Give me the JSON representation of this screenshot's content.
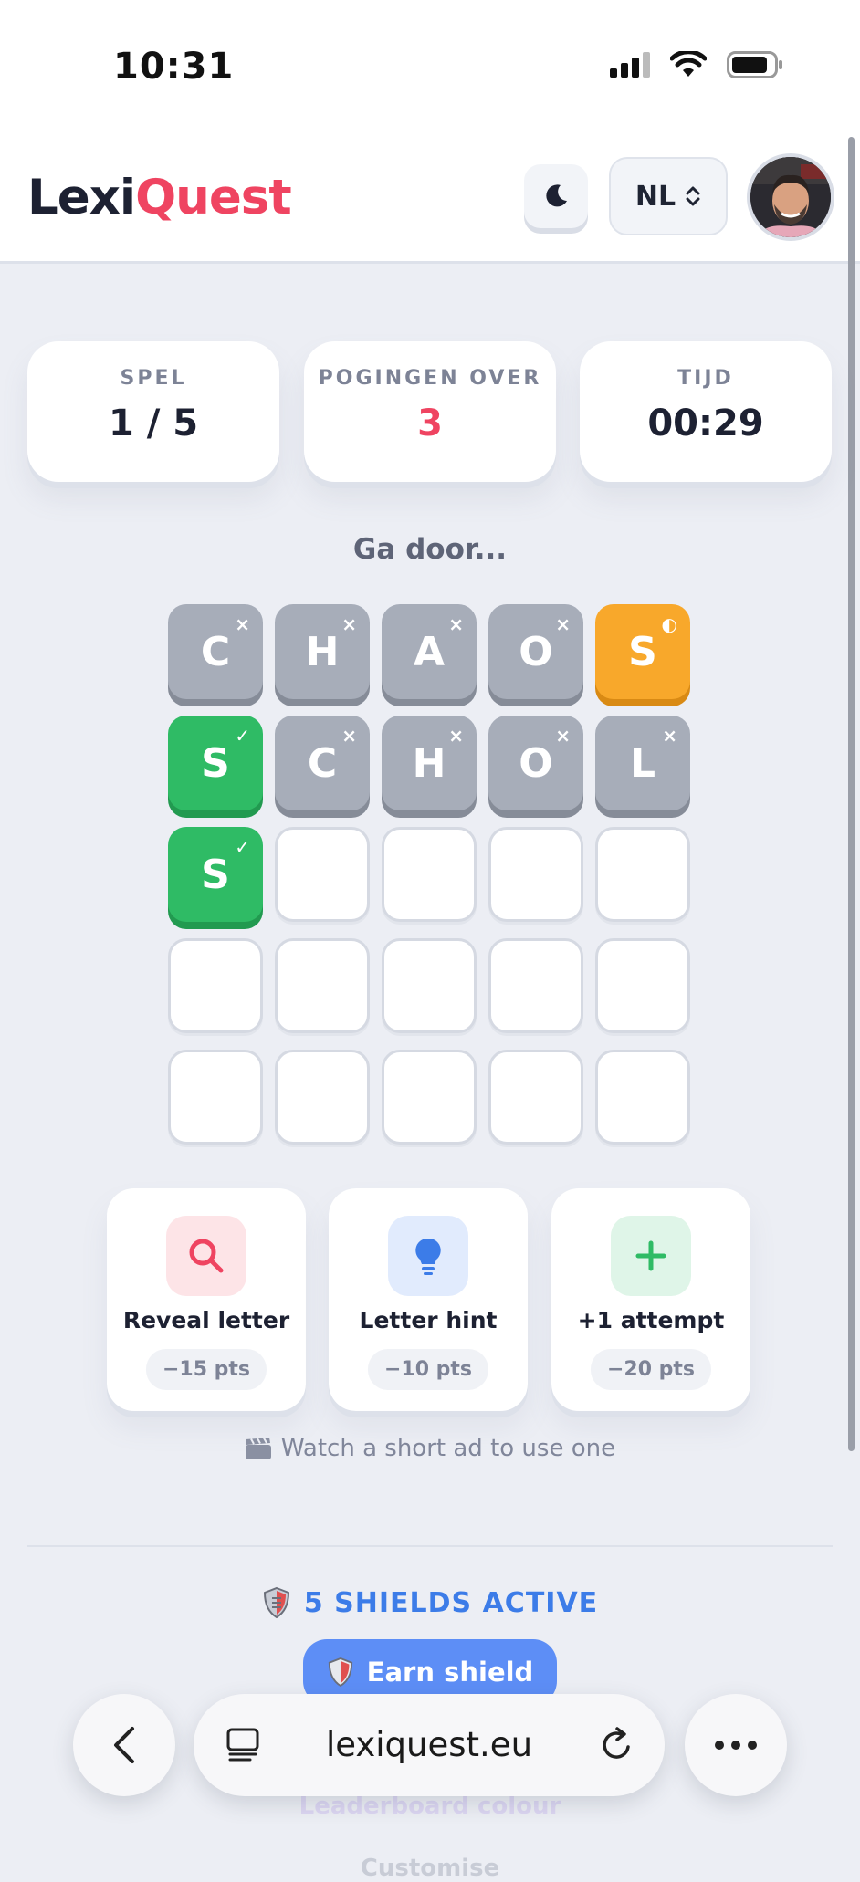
{
  "status_bar": {
    "time": "10:31"
  },
  "header": {
    "logo_part1": "Lexi",
    "logo_part2": "Quest",
    "language": "NL"
  },
  "stats": [
    {
      "label": "SPEL",
      "value": "1 / 5"
    },
    {
      "label": "POGINGEN OVER",
      "value": "3"
    },
    {
      "label": "TIJD",
      "value": "00:29"
    }
  ],
  "message": "Ga door...",
  "board": {
    "rows": [
      [
        {
          "letter": "C",
          "state": "absent",
          "mark": "×"
        },
        {
          "letter": "H",
          "state": "absent",
          "mark": "×"
        },
        {
          "letter": "A",
          "state": "absent",
          "mark": "×"
        },
        {
          "letter": "O",
          "state": "absent",
          "mark": "×"
        },
        {
          "letter": "S",
          "state": "present",
          "mark": "◐"
        }
      ],
      [
        {
          "letter": "S",
          "state": "correct",
          "mark": "✓"
        },
        {
          "letter": "C",
          "state": "absent",
          "mark": "×"
        },
        {
          "letter": "H",
          "state": "absent",
          "mark": "×"
        },
        {
          "letter": "O",
          "state": "absent",
          "mark": "×"
        },
        {
          "letter": "L",
          "state": "absent",
          "mark": "×"
        }
      ],
      [
        {
          "letter": "S",
          "state": "correct",
          "mark": "✓"
        },
        {
          "letter": "",
          "state": "empty",
          "mark": ""
        },
        {
          "letter": "",
          "state": "empty",
          "mark": ""
        },
        {
          "letter": "",
          "state": "empty",
          "mark": ""
        },
        {
          "letter": "",
          "state": "empty",
          "mark": ""
        }
      ],
      [
        {
          "letter": "",
          "state": "empty",
          "mark": ""
        },
        {
          "letter": "",
          "state": "empty",
          "mark": ""
        },
        {
          "letter": "",
          "state": "empty",
          "mark": ""
        },
        {
          "letter": "",
          "state": "empty",
          "mark": ""
        },
        {
          "letter": "",
          "state": "empty",
          "mark": ""
        }
      ],
      [
        {
          "letter": "",
          "state": "empty",
          "mark": ""
        },
        {
          "letter": "",
          "state": "empty",
          "mark": ""
        },
        {
          "letter": "",
          "state": "empty",
          "mark": ""
        },
        {
          "letter": "",
          "state": "empty",
          "mark": ""
        },
        {
          "letter": "",
          "state": "empty",
          "mark": ""
        }
      ]
    ]
  },
  "powerups": [
    {
      "label": "Reveal letter",
      "cost": "−15 pts",
      "icon": "magnifier-icon"
    },
    {
      "label": "Letter hint",
      "cost": "−10 pts",
      "icon": "lightbulb-icon"
    },
    {
      "label": "+1 attempt",
      "cost": "−20 pts",
      "icon": "plus-icon"
    }
  ],
  "ad_note": "Watch a short ad to use one",
  "shields": {
    "status": "5 SHIELDS ACTIVE",
    "earn_button": "Earn shield"
  },
  "below_fold": {
    "leaderboard": "Leaderboard colour",
    "customise": "Customise"
  },
  "browser": {
    "url": "lexiquest.eu"
  },
  "colors": {
    "brand_red": "#ef4461",
    "absent": "#a7adb9",
    "present": "#f8a82b",
    "correct": "#2fbb65",
    "shield_blue": "#3c7ce8"
  }
}
